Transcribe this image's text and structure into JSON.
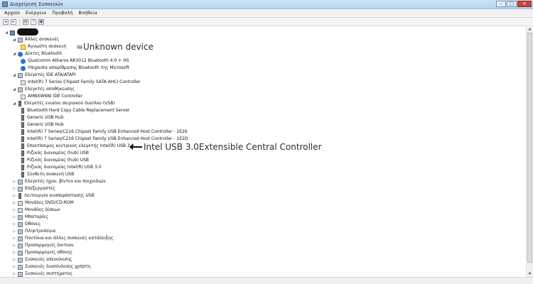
{
  "window": {
    "title": "Διαχείριση Συσκευών"
  },
  "menu": [
    "Αρχείο",
    "Ενέργεια",
    "Προβολή",
    "Βοήθεια"
  ],
  "tree": [
    {
      "level": 0,
      "icon": "computer-icon",
      "label": "",
      "expanded": true,
      "redacted": true
    },
    {
      "level": 1,
      "icon": "other-devices-icon",
      "label": "Άλλες συσκευές",
      "expanded": true
    },
    {
      "level": 2,
      "icon": "warning-device-icon",
      "label": "Άγνωστη συσκευή"
    },
    {
      "level": 1,
      "icon": "bluetooth-icon",
      "label": "Δέκτες Bluetooth",
      "expanded": true
    },
    {
      "level": 2,
      "icon": "bluetooth-icon",
      "label": "Qualcomm Atheros AR3012 Bluetooth 4.0 + HS"
    },
    {
      "level": 2,
      "icon": "bluetooth-icon",
      "label": "Υπηρεσία απαρίθμησης Bluetooth της Microsoft"
    },
    {
      "level": 1,
      "icon": "ide-controller-icon",
      "label": "Ελεγκτές IDE ATA/ATAPI",
      "expanded": true
    },
    {
      "level": 2,
      "icon": "ide-controller-icon",
      "label": "Intel(R) 7 Series Chipset Family SATA AHCI Controller"
    },
    {
      "level": 1,
      "icon": "storage-controller-icon",
      "label": "Ελεγκτές αποθήκευσης",
      "expanded": true
    },
    {
      "level": 2,
      "icon": "storage-controller-icon",
      "label": "AMBXW6NI IDE Controller"
    },
    {
      "level": 1,
      "icon": "usb-icon",
      "label": "Ελεγκτές ενιαίου σειριακού διαύλου (USB)",
      "expanded": true
    },
    {
      "level": 2,
      "icon": "usb-icon",
      "label": "Bluetooth Hard Copy Cable Replacement Server"
    },
    {
      "level": 2,
      "icon": "usb-icon",
      "label": "Generic USB Hub"
    },
    {
      "level": 2,
      "icon": "usb-icon",
      "label": "Generic USB Hub"
    },
    {
      "level": 2,
      "icon": "usb-icon",
      "label": "Intel(R) 7 Series/C216 Chipset Family USB Enhanced Host Controller - 1E26"
    },
    {
      "level": 2,
      "icon": "usb-icon",
      "label": "Intel(R) 7 Series/C216 Chipset Family USB Enhanced Host Controller - 1E2D"
    },
    {
      "level": 2,
      "icon": "usb-icon",
      "label": "Επεκτάσιμος κεντρικός ελεγκτής Intel(R) USB 3.0"
    },
    {
      "level": 2,
      "icon": "usb-icon",
      "label": "Ριζικός διανομέας (hub) USB"
    },
    {
      "level": 2,
      "icon": "usb-icon",
      "label": "Ριζικός διανομέας (hub) USB"
    },
    {
      "level": 2,
      "icon": "usb-icon",
      "label": "Ριζικός διανομέας Intel(R) USB 3.0"
    },
    {
      "level": 2,
      "icon": "usb-icon",
      "label": "Σύνθετη συσκευή USB"
    },
    {
      "level": 1,
      "icon": "sound-icon",
      "label": "Ελεγκτές ήχου, βίντεο και παιχνιδιών"
    },
    {
      "level": 1,
      "icon": "processor-icon",
      "label": "Επεξεργαστές"
    },
    {
      "level": 1,
      "icon": "usb-icon",
      "label": "Λειτουργία αναπαράστασης USB"
    },
    {
      "level": 1,
      "icon": "dvd-drive-icon",
      "label": "Μονάδες DVD/CD-ROM"
    },
    {
      "level": 1,
      "icon": "disk-drive-icon",
      "label": "Μονάδες δίσκων"
    },
    {
      "level": 1,
      "icon": "battery-icon",
      "label": "Μπαταρίες"
    },
    {
      "level": 1,
      "icon": "monitor-icon",
      "label": "Οθόνες"
    },
    {
      "level": 1,
      "icon": "keyboard-icon",
      "label": "Πληκτρολόγια"
    },
    {
      "level": 1,
      "icon": "mouse-icon",
      "label": "Ποντίκια και άλλες συσκευές κατάδειξης"
    },
    {
      "level": 1,
      "icon": "network-adapter-icon",
      "label": "Προσαρμογείς δικτύου"
    },
    {
      "level": 1,
      "icon": "display-adapter-icon",
      "label": "Προσαρμογείς οθόνης"
    },
    {
      "level": 1,
      "icon": "imaging-device-icon",
      "label": "Συσκευές απεικόνισης"
    },
    {
      "level": 1,
      "icon": "hid-icon",
      "label": "Συσκευές διασύνδεσης χρήστη"
    },
    {
      "level": 1,
      "icon": "system-device-icon",
      "label": "Συσκευές συστήματος"
    }
  ],
  "annotations": {
    "unknown_device": "=Unknown device",
    "usb3_controller": "Intel USB 3.0Extensible Central Controller"
  }
}
